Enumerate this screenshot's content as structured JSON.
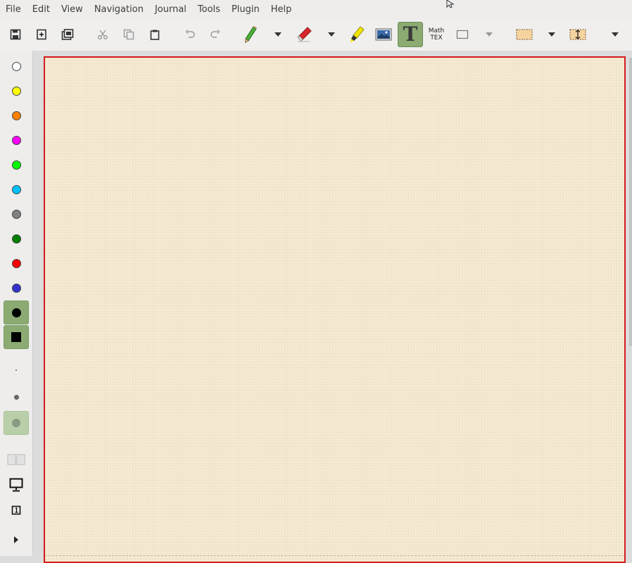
{
  "menu": {
    "items": [
      "File",
      "Edit",
      "View",
      "Navigation",
      "Journal",
      "Tools",
      "Plugin",
      "Help"
    ]
  },
  "toolbar": {
    "tools": [
      {
        "icon": "save-icon"
      },
      {
        "icon": "new-page-icon"
      },
      {
        "icon": "print-icon"
      },
      {
        "icon": "cut-icon"
      },
      {
        "icon": "copy-icon"
      },
      {
        "icon": "paste-icon"
      },
      {
        "icon": "undo-icon"
      },
      {
        "icon": "redo-icon"
      },
      {
        "icon": "pen-icon"
      },
      {
        "icon": "eraser-icon"
      },
      {
        "icon": "highlighter-icon"
      },
      {
        "icon": "image-icon"
      },
      {
        "icon": "text-icon",
        "active": true
      },
      {
        "icon": "tex-icon"
      },
      {
        "icon": "shape-icon"
      },
      {
        "icon": "select-rect-icon"
      },
      {
        "icon": "vertical-space-icon"
      }
    ],
    "tex_label_top": "Math",
    "tex_label_bottom": "TEX",
    "text_tool_glyph": "T"
  },
  "palette": {
    "colors": [
      {
        "name": "white",
        "hex": "#ffffff"
      },
      {
        "name": "yellow",
        "hex": "#ffff00"
      },
      {
        "name": "orange",
        "hex": "#ff8000"
      },
      {
        "name": "magenta",
        "hex": "#ff00ff"
      },
      {
        "name": "green",
        "hex": "#00ff00"
      },
      {
        "name": "light-blue",
        "hex": "#00c0ff"
      },
      {
        "name": "gray",
        "hex": "#808080"
      },
      {
        "name": "dark-green",
        "hex": "#008000"
      },
      {
        "name": "red",
        "hex": "#ff0000"
      },
      {
        "name": "blue",
        "hex": "#3333cc"
      },
      {
        "name": "black",
        "hex": "#000000",
        "active": true
      }
    ],
    "fill_active": true,
    "sizes": [
      "fine",
      "medium",
      "thick"
    ],
    "active_size": "thick"
  },
  "colors": {
    "page_background": "#f6ead3",
    "page_border": "#d41c1c",
    "active_tool": "#8bab72"
  }
}
